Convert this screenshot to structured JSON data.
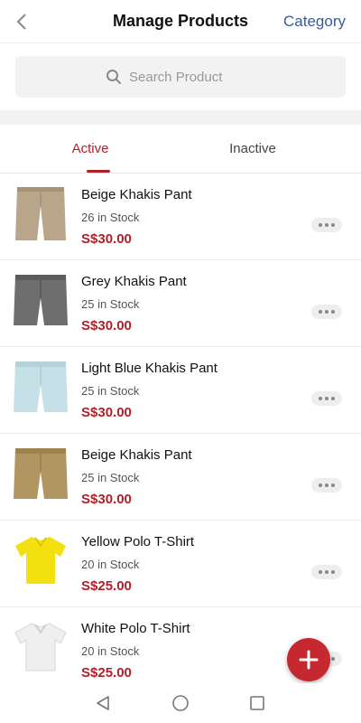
{
  "header": {
    "title": "Manage Products",
    "category_label": "Category"
  },
  "search": {
    "placeholder": "Search Product"
  },
  "tabs": [
    {
      "label": "Active",
      "selected": true
    },
    {
      "label": "Inactive",
      "selected": false
    }
  ],
  "products": [
    {
      "name": "Beige Khakis Pant",
      "stock": "26  in Stock",
      "price": "S$30.00",
      "image": "beige-pants",
      "color": "#b8a58a"
    },
    {
      "name": "Grey Khakis Pant",
      "stock": "25  in Stock",
      "price": "S$30.00",
      "image": "grey-shorts",
      "color": "#6e6e6e"
    },
    {
      "name": "Light Blue Khakis Pant",
      "stock": "25  in Stock",
      "price": "S$30.00",
      "image": "lightblue-shorts",
      "color": "#c5e0e6"
    },
    {
      "name": "Beige Khakis Pant",
      "stock": "25  in Stock",
      "price": "S$30.00",
      "image": "khaki-shorts",
      "color": "#b09660"
    },
    {
      "name": "Yellow Polo T-Shirt",
      "stock": "20  in Stock",
      "price": "S$25.00",
      "image": "yellow-polo",
      "color": "#f2e10f"
    },
    {
      "name": "White Polo T-Shirt",
      "stock": "20  in Stock",
      "price": "S$25.00",
      "image": "white-polo",
      "color": "#efefef"
    }
  ],
  "colors": {
    "accent": "#b22026",
    "link": "#3a5a9a",
    "fab": "#c5282e"
  }
}
